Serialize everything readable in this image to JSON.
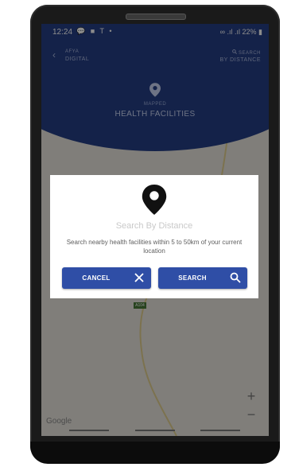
{
  "status_bar": {
    "time": "12:24",
    "left_icons": "💬 ■ T •",
    "battery": "22%"
  },
  "nav": {
    "back_line1": "AFYA",
    "back_line2": "DIGITAL",
    "search_line1": "SEARCH",
    "search_line2": "BY DISTANCE"
  },
  "header": {
    "subtitle": "MAPPED",
    "title": "HEALTH FACILITIES"
  },
  "map": {
    "zoom_in": "+",
    "zoom_out": "−",
    "attribution": "Google",
    "road_badge": "A104"
  },
  "dialog": {
    "title": "Search By Distance",
    "message": "Search nearby health facilities within 5 to 50km of your current location",
    "cancel_label": "CANCEL",
    "search_label": "SEARCH"
  },
  "colors": {
    "header_blue": "#263f86",
    "button_blue": "#2f4ea6"
  },
  "icons": {
    "header_pin": "location-pin-icon",
    "dialog_pin": "location-pin-icon",
    "cancel": "close-icon",
    "search": "search-icon"
  }
}
